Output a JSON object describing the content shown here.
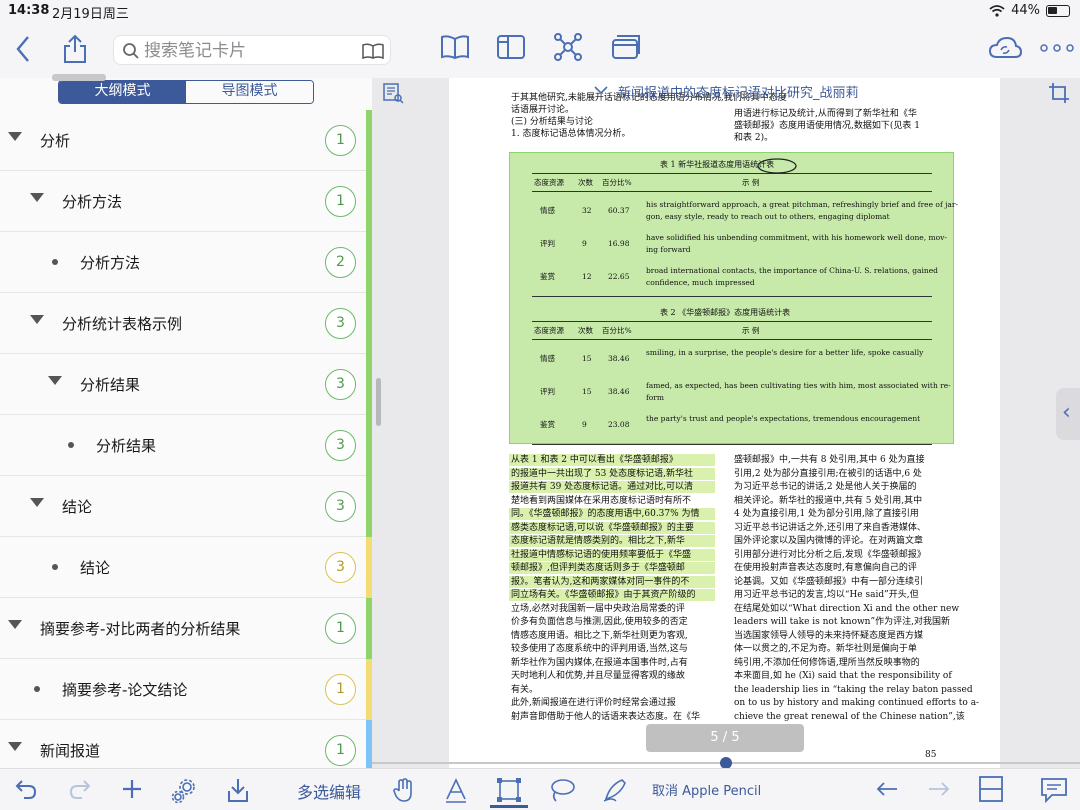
{
  "status": {
    "time": "14:38",
    "date": "2月19日周三",
    "battery": "44%"
  },
  "toolbar": {
    "search_placeholder": "搜索笔记卡片"
  },
  "mode_tabs": [
    {
      "label": "大纲模式",
      "active": true
    },
    {
      "label": "导图模式",
      "active": false
    }
  ],
  "outline": [
    {
      "label": "分析",
      "kind": "triangle",
      "indent": 0,
      "badge": "1",
      "badge_color": "green",
      "stripe": "#8fd36b"
    },
    {
      "label": "分析方法",
      "kind": "triangle",
      "indent": 1,
      "badge": "1",
      "badge_color": "green",
      "stripe": "#8fd36b"
    },
    {
      "label": "分析方法",
      "kind": "dot",
      "indent": 2,
      "badge": "2",
      "badge_color": "green",
      "stripe": "#8fd36b"
    },
    {
      "label": "分析统计表格示例",
      "kind": "triangle",
      "indent": 1,
      "badge": "3",
      "badge_color": "green",
      "stripe": "#8fd36b"
    },
    {
      "label": "分析结果",
      "kind": "triangle",
      "indent": 2,
      "badge": "3",
      "badge_color": "green",
      "stripe": "#8fd36b"
    },
    {
      "label": "分析结果",
      "kind": "dot",
      "indent": 3,
      "badge": "3",
      "badge_color": "green",
      "stripe": "#8fd36b"
    },
    {
      "label": "结论",
      "kind": "triangle",
      "indent": 1,
      "badge": "3",
      "badge_color": "green",
      "stripe": "#8fd36b"
    },
    {
      "label": "结论",
      "kind": "dot",
      "indent": 2,
      "badge": "3",
      "badge_color": "yellow",
      "stripe": "#f4dc74"
    },
    {
      "label": "摘要参考-对比两者的分析结果",
      "kind": "triangle",
      "indent": 0,
      "badge": "1",
      "badge_color": "green",
      "stripe": "#8fd36b"
    },
    {
      "label": "摘要参考-论文结论",
      "kind": "dot",
      "indent": 1,
      "badge": "1",
      "badge_color": "yellow",
      "stripe": "#f4dc74"
    },
    {
      "label": "新闻报道",
      "kind": "triangle",
      "indent": 0,
      "badge": "1",
      "badge_color": "green",
      "stripe": "#7ec3f5"
    }
  ],
  "left_bottom": {
    "multi_edit": "多选编辑"
  },
  "doc": {
    "title": "新闻报道中的态度标记语对比研究_战丽莉",
    "page_indicator": "5 / 5",
    "page_number": "85",
    "pencil_cancel": "取消 Apple Pencil",
    "top_left_lines": [
      "于其其他研究,未能展开话语标记的态度用语分布情况,我们将其中态度",
      "话语展开讨论。",
      "(三) 分析结果与讨论",
      "1. 态度标记语总体情况分析。"
    ],
    "top_right_lines": [
      "用语进行标记及统计,从而得到了新华社和《华",
      "盛顿邮报》态度用语使用情况,数据如下(见表 1",
      "和表 2)。"
    ],
    "table1": {
      "caption": "表 1   新华社报道态度用语统计表",
      "headers": [
        "态度资源",
        "次数",
        "百分比%",
        "示          例"
      ],
      "rows": [
        {
          "res": "情感",
          "count": "32",
          "pct": "60.37",
          "ex1": "his straightforward approach, a great pitchman, refreshingly brief and free of jar-",
          "ex2": "gon, easy style, ready to reach out to others, engaging diplomat"
        },
        {
          "res": "评判",
          "count": "9",
          "pct": "16.98",
          "ex1": "have solidified his unbending commitment, with his homework well done, mov-",
          "ex2": "ing forward"
        },
        {
          "res": "鉴赏",
          "count": "12",
          "pct": "22.65",
          "ex1": "broad international contacts, the importance of China-U. S. relations, gained",
          "ex2": "confidence, much impressed"
        }
      ]
    },
    "table2": {
      "caption": "表 2   《华盛顿邮报》态度用语统计表",
      "headers": [
        "态度资源",
        "次数",
        "百分比%",
        "示          例"
      ],
      "rows": [
        {
          "res": "情感",
          "count": "15",
          "pct": "38.46",
          "ex1": "smiling, in a surprise, the people's desire for a better life, spoke casually",
          "ex2": ""
        },
        {
          "res": "评判",
          "count": "15",
          "pct": "38.46",
          "ex1": "famed, as expected, has been cultivating ties with him, most associated with re-",
          "ex2": "form"
        },
        {
          "res": "鉴赏",
          "count": "9",
          "pct": "23.08",
          "ex1": "the party's trust and people's expectations, tremendous encouragement",
          "ex2": ""
        }
      ]
    },
    "bottom_left_lines": [
      "从表 1 和表 2 中可以看出《华盛顿邮报》",
      "的报道中一共出现了 53 处态度标记语,新华社",
      "报道共有 39 处态度标记语。通过对比,可以清",
      "楚地看到两国媒体在采用态度标记语时有所不",
      "同。《华盛顿邮报》的态度用语中,60.37% 为情",
      "感类态度标记语,可以说《华盛顿邮报》的主要",
      "态度标记语就是情感类别的。相比之下,新华",
      "社报道中情感标记语的使用频率要低于《华盛",
      "顿邮报》,但评判类态度话则多于《华盛顿邮",
      "报》。笔者认为,这和两家媒体对同一事件的不",
      "同立场有关。《华盛顿邮报》由于其资产阶级的",
      "立场,必然对我国新一届中央政治局常委的评",
      "价多有负面信息与推测,因此,使用较多的否定",
      "情感态度用语。相比之下,新华社则更为客观,",
      "较多使用了态度系统中的评判用语,当然,这与",
      "新华社作为国内媒体,在报道本国事件时,占有",
      "天时地利人和优势,并且尽量显得客观的缘故",
      "有关。",
      "  此外,新闻报道在进行评价时经常会通过报",
      "射声音即借助于他人的话语来表达态度。在《华"
    ],
    "bottom_right_lines": [
      "盛顿邮报》中,一共有 8 处引用,其中 6 处为直接",
      "引用,2 处为部分直接引用;在被引的话语中,6 处",
      "为习近平总书记的讲话,2 处是他人关于换届的",
      "相关评论。新华社的报道中,共有 5 处引用,其中",
      "4 处为直接引用,1 处为部分引用,除了直接引用",
      "习近平总书记讲话之外,还引用了来自香港媒体、",
      "国外评论家以及国内微博的评论。在对两篇文章",
      "引用部分进行对比分析之后,发现《华盛顿邮报》",
      "在使用投射声音表达态度时,有意偏向自己的评",
      "论基调。又如《华盛顿邮报》中有一部分连续引",
      "用习近平总书记的发言,均以“He said”开头,但",
      "在结尾处如以“What direction Xi and the other new",
      "leaders will take is not known”作为评注,对我国新",
      "当选国家领导人领导的未来持怀疑态度是西方媒",
      "体一以贯之的,不足为奇。新华社则是偏向于单",
      "纯引用,不添加任何修饰语,理所当然反映事物的",
      "本来面目,如 he (Xi) said that the responsibility of",
      "the leadership lies in “taking the relay baton passed",
      "on to us by history and making continued efforts to a-",
      "chieve the great renewal of the Chinese nation”,该"
    ]
  }
}
